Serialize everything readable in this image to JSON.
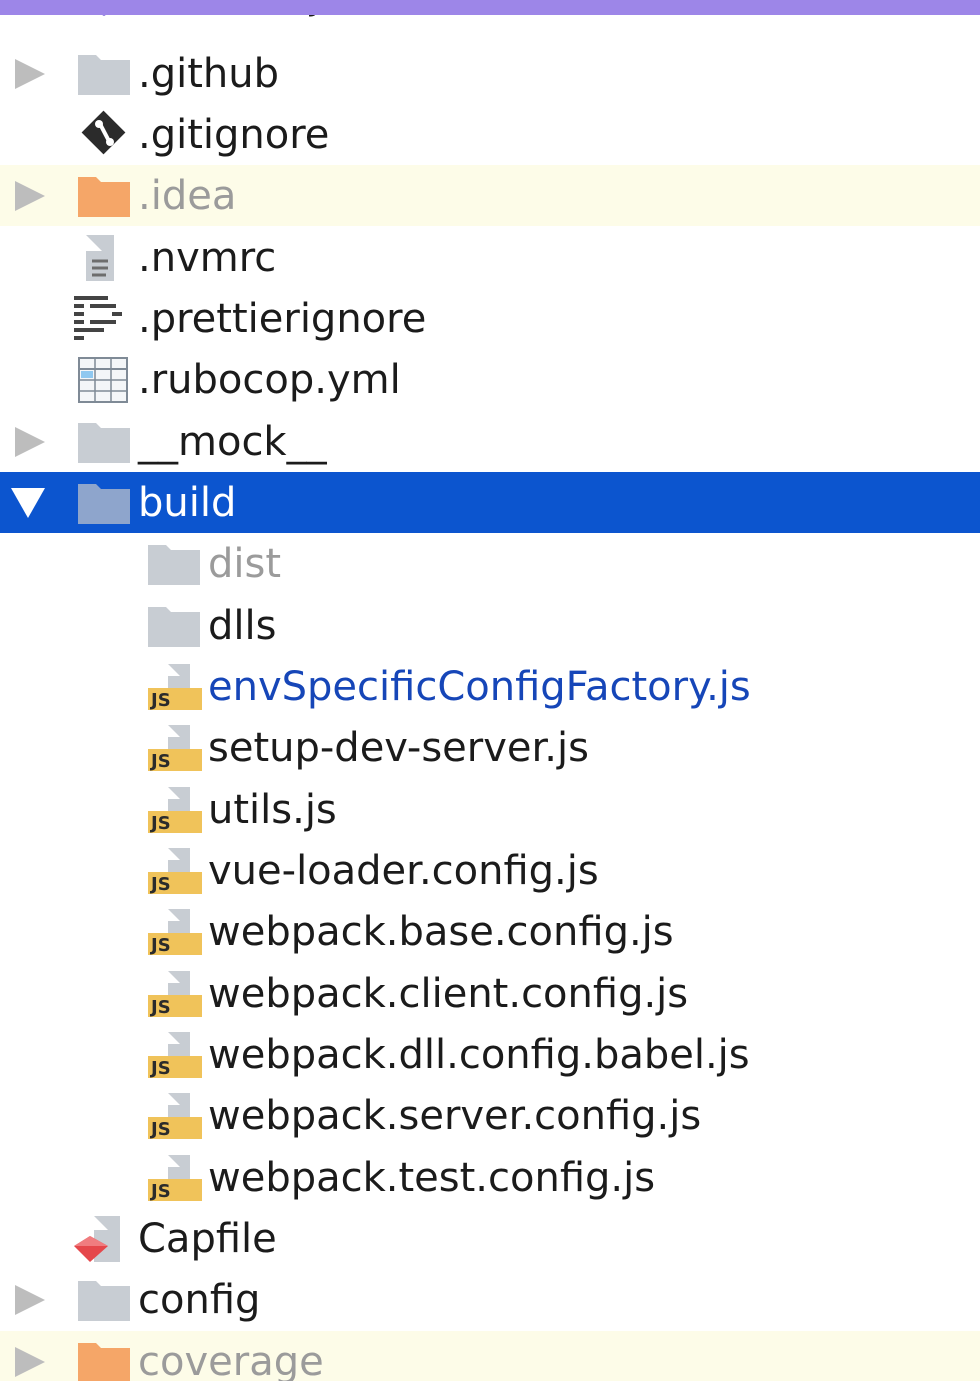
{
  "colors": {
    "window_accent": "#9d86e8",
    "selection": "#0c55cf",
    "ignored_row": "#fdfce8",
    "folder": "#c8cdd3",
    "excluded_folder": "#f5a668",
    "js_badge": "#f0c35a",
    "modified_text": "#1646b8"
  },
  "tree": {
    "items": [
      {
        "name": ".eslintrc.js",
        "icon": "eslint-icon"
      },
      {
        "name": ".github",
        "icon": "folder-icon"
      },
      {
        "name": ".gitignore",
        "icon": "git-icon"
      },
      {
        "name": ".idea",
        "icon": "excluded-folder-icon"
      },
      {
        "name": ".nvmrc",
        "icon": "text-file-icon"
      },
      {
        "name": ".prettierignore",
        "icon": "prettier-icon"
      },
      {
        "name": ".rubocop.yml",
        "icon": "yaml-file-icon"
      },
      {
        "name": "__mock__",
        "icon": "folder-icon"
      },
      {
        "name": "build",
        "icon": "folder-icon",
        "state": "expanded, selected"
      },
      {
        "name": "dist",
        "icon": "folder-icon"
      },
      {
        "name": "dlls",
        "icon": "folder-icon"
      },
      {
        "name": "envSpecificConfigFactory.js",
        "icon": "js-file-icon"
      },
      {
        "name": "setup-dev-server.js",
        "icon": "js-file-icon"
      },
      {
        "name": "utils.js",
        "icon": "js-file-icon"
      },
      {
        "name": "vue-loader.config.js",
        "icon": "js-file-icon"
      },
      {
        "name": "webpack.base.config.js",
        "icon": "js-file-icon"
      },
      {
        "name": "webpack.client.config.js",
        "icon": "js-file-icon"
      },
      {
        "name": "webpack.dll.config.babel.js",
        "icon": "js-file-icon"
      },
      {
        "name": "webpack.server.config.js",
        "icon": "js-file-icon"
      },
      {
        "name": "webpack.test.config.js",
        "icon": "js-file-icon"
      },
      {
        "name": "Capfile",
        "icon": "capistrano-file-icon"
      },
      {
        "name": "config",
        "icon": "folder-icon"
      },
      {
        "name": "coverage",
        "icon": "excluded-folder-icon"
      }
    ]
  }
}
